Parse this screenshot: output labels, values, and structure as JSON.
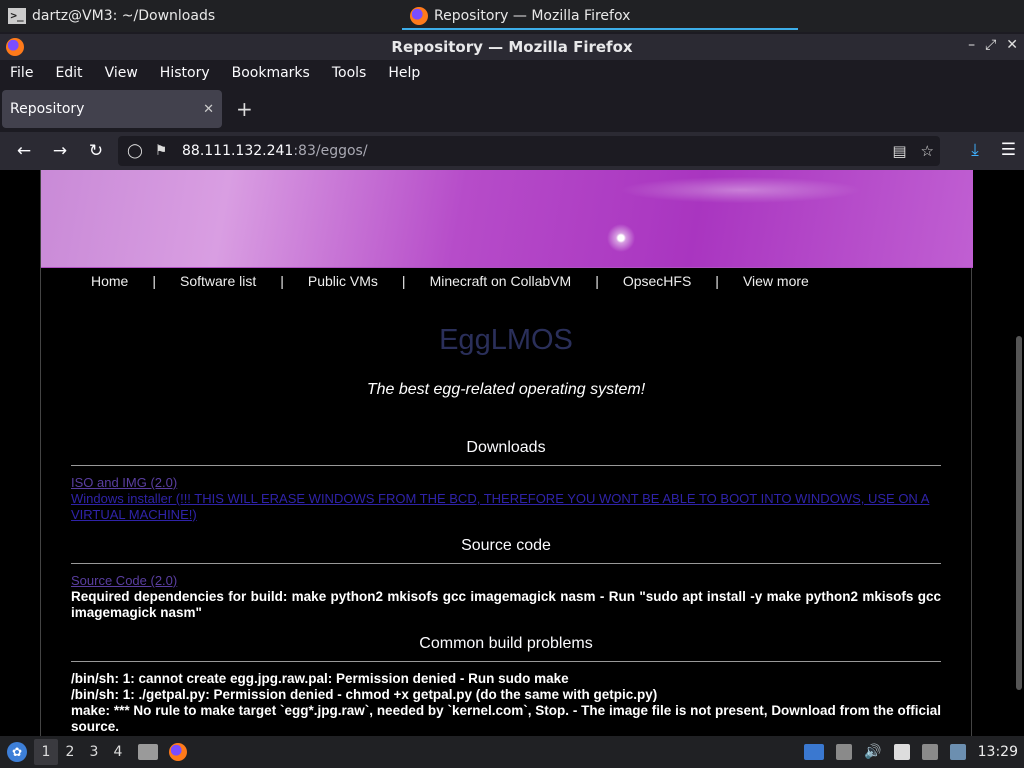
{
  "desktop": {
    "tasks": [
      {
        "label": "dartz@VM3: ~/Downloads"
      },
      {
        "label": "Repository — Mozilla Firefox"
      }
    ],
    "workspaces": [
      "1",
      "2",
      "3",
      "4"
    ],
    "clock": "13:29"
  },
  "window": {
    "title": "Repository — Mozilla Firefox"
  },
  "menu": [
    "File",
    "Edit",
    "View",
    "History",
    "Bookmarks",
    "Tools",
    "Help"
  ],
  "tab": {
    "title": "Repository"
  },
  "url": {
    "host": "88.111.132.241",
    "path": ":83/eggos/"
  },
  "page": {
    "nav": [
      "Home",
      "Software list",
      "Public VMs",
      "Minecraft on CollabVM",
      "OpsecHFS",
      "View more"
    ],
    "separator": "|",
    "title": "EggLMOS",
    "tagline": "The best egg-related operating system!",
    "downloads": {
      "heading": "Downloads",
      "links": [
        "ISO and IMG (2.0)",
        "Windows installer (!!! THIS WILL ERASE WINDOWS FROM THE BCD, THEREFORE YOU WONT BE ABLE TO BOOT INTO WINDOWS, USE ON A VIRTUAL MACHINE!)"
      ]
    },
    "source": {
      "heading": "Source code",
      "link": "Source Code (2.0)",
      "note": "Required dependencies for build: make python2 mkisofs gcc imagemagick nasm - Run \"sudo apt install -y make python2 mkisofs gcc imagemagick nasm\""
    },
    "problems": {
      "heading": "Common build problems",
      "lines": [
        "/bin/sh: 1: cannot create egg.jpg.raw.pal: Permission denied - Run sudo make",
        "/bin/sh: 1: ./getpal.py: Permission denied - chmod +x getpal.py (do the same with getpic.py)",
        "make: *** No rule to make target `egg*.jpg.raw`, needed by `kernel.com`, Stop. - The image file is not present, Download from the official source."
      ]
    }
  }
}
